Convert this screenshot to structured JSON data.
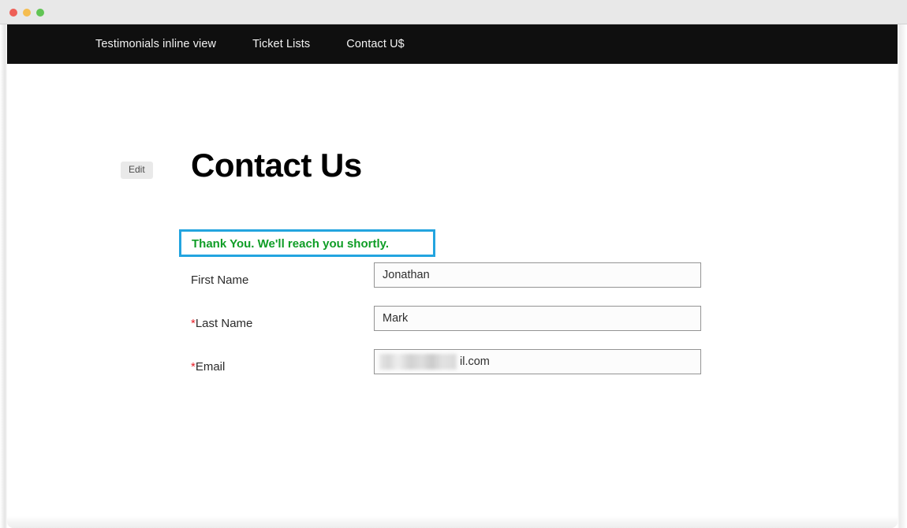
{
  "window": {
    "traffic_lights": [
      {
        "name": "close",
        "color": "#ee5f56"
      },
      {
        "name": "minimize",
        "color": "#f5bd4f"
      },
      {
        "name": "zoom",
        "color": "#61c454"
      }
    ]
  },
  "navbar": {
    "items": [
      {
        "label": "Testimonials inline view"
      },
      {
        "label": "Ticket Lists"
      },
      {
        "label": "Contact U$"
      }
    ]
  },
  "page": {
    "edit_label": "Edit",
    "title": "Contact Us"
  },
  "success": {
    "message": "Thank You. We'll reach you shortly.",
    "text_color": "#0f9d26",
    "annotation_color": "#23a4df"
  },
  "form": {
    "required_marker": "*",
    "fields": [
      {
        "label": "First Name",
        "required": false,
        "value": "Jonathan",
        "placeholder": "First Name"
      },
      {
        "label": "Last Name",
        "required": true,
        "value": "Mark",
        "placeholder": "Last Name"
      },
      {
        "label": "Email",
        "required": true,
        "value": "il.com",
        "placeholder": "Email",
        "redacted": true
      }
    ]
  }
}
